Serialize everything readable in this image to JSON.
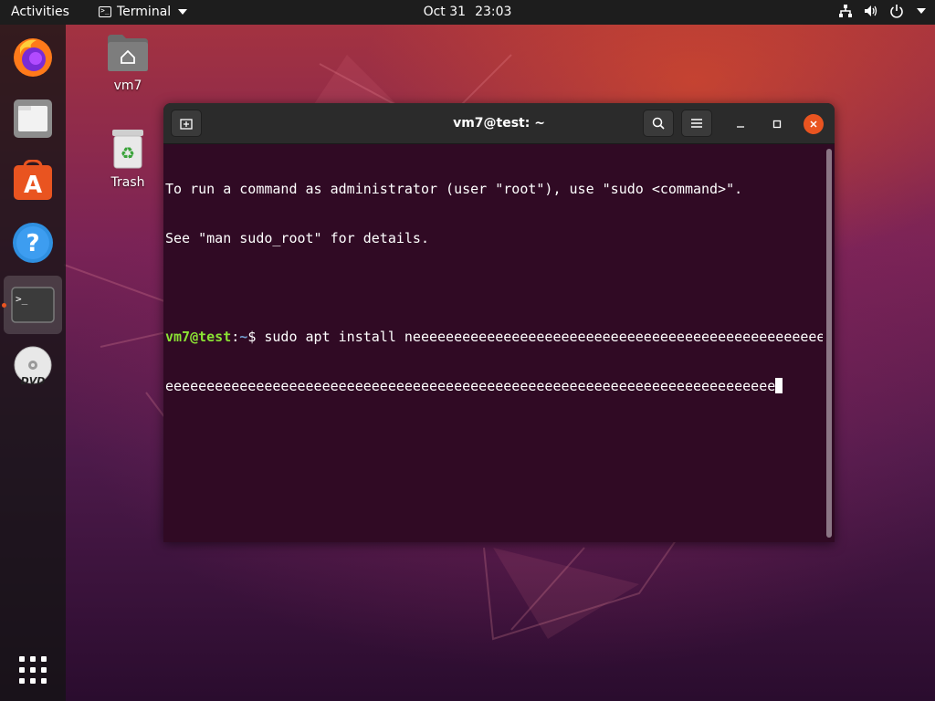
{
  "topbar": {
    "activities": "Activities",
    "app_name": "Terminal",
    "app_icon_glyph": ">_",
    "date": "Oct 31",
    "time": "23:03",
    "status_icons": [
      "network-icon",
      "volume-icon",
      "power-icon",
      "system-menu-caret-icon"
    ]
  },
  "dock": {
    "items": [
      {
        "name": "firefox",
        "icon": "firefox-icon"
      },
      {
        "name": "files",
        "icon": "files-icon"
      },
      {
        "name": "ubuntu-software",
        "icon": "software-center-icon",
        "glyph": "A"
      },
      {
        "name": "help",
        "icon": "help-icon",
        "glyph": "?"
      },
      {
        "name": "terminal",
        "icon": "terminal-icon",
        "glyph": ">_",
        "active": true
      },
      {
        "name": "dvd",
        "icon": "dvd-icon",
        "glyph": "DVD"
      }
    ],
    "show_apps_icon": "app-grid-icon"
  },
  "desktop": {
    "icons": [
      {
        "label": "vm7",
        "icon": "home-folder-icon"
      },
      {
        "label": "Trash",
        "icon": "trash-icon"
      }
    ]
  },
  "terminal": {
    "title": "vm7@test: ~",
    "header_buttons": [
      "new-tab-icon",
      "search-icon",
      "hamburger-menu-icon"
    ],
    "window_controls": [
      "minimize-icon",
      "maximize-icon",
      "close-icon"
    ],
    "lines": [
      "To run a command as administrator (user \"root\"), use \"sudo <command>\".",
      "See \"man sudo_root\" for details."
    ],
    "prompt": {
      "user_host": "vm7@test",
      "separator": ":",
      "path": "~",
      "symbol": "$ ",
      "command_line1": "sudo apt install neeeeeeeeeeeeeeeeeeeeeeeeeeeeeeeeeeeeeeeeeeeeeeeeeeeeee",
      "command_line2": "eeeeeeeeeeeeeeeeeeeeeeeeeeeeeeeeeeeeeeeeeeeeeeeeeeeeeeeeeeeeeeeeeeeeeeeeee"
    },
    "colors": {
      "background": "#300a24",
      "prompt_user": "#8ae234",
      "prompt_path": "#729fcf",
      "text": "#ffffff"
    }
  },
  "colors": {
    "accent": "#e95420",
    "topbar": "#1d1d1d"
  }
}
